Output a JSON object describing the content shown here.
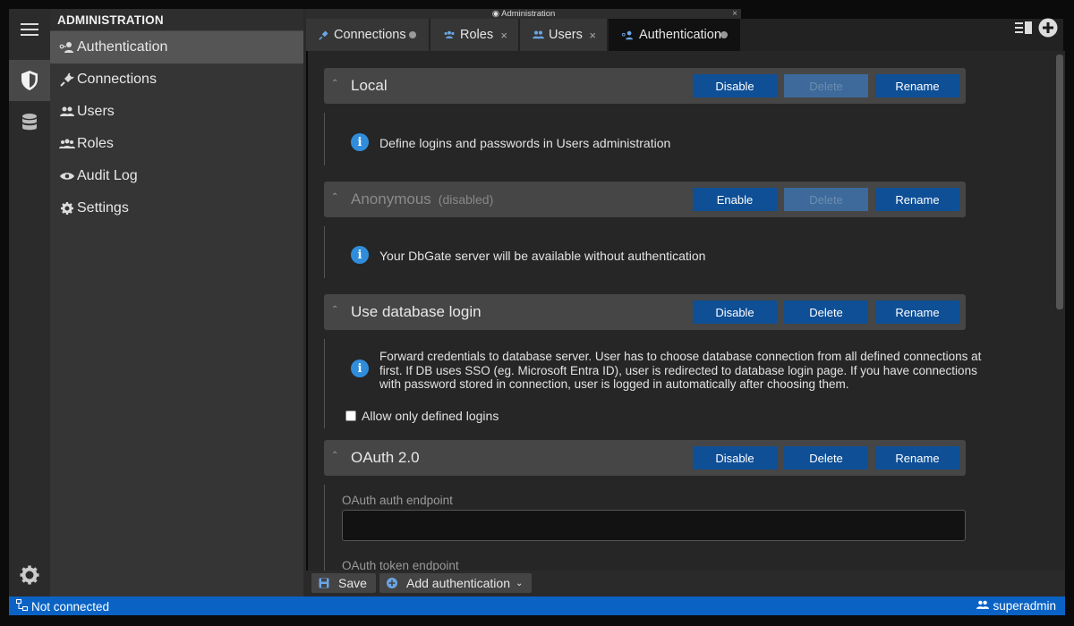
{
  "window_title": "Administration",
  "sidebar": {
    "header": "ADMINISTRATION",
    "items": [
      {
        "label": "Authentication",
        "icon": "user-key-icon"
      },
      {
        "label": "Connections",
        "icon": "plug-icon"
      },
      {
        "label": "Users",
        "icon": "users-icon"
      },
      {
        "label": "Roles",
        "icon": "roles-icon"
      },
      {
        "label": "Audit Log",
        "icon": "eye-icon"
      },
      {
        "label": "Settings",
        "icon": "gear-icon"
      }
    ]
  },
  "tabs": [
    {
      "label": "Connections",
      "mark": "dot"
    },
    {
      "label": "Roles",
      "mark": "×"
    },
    {
      "label": "Users",
      "mark": "×"
    },
    {
      "label": "Authentication",
      "mark": "dot",
      "active": true
    }
  ],
  "buttons": {
    "enable": "Enable",
    "disable": "Disable",
    "delete": "Delete",
    "rename": "Rename"
  },
  "sections": {
    "local": {
      "name": "Local",
      "info": "Define logins and passwords in Users administration"
    },
    "anonymous": {
      "name": "Anonymous",
      "state": "(disabled)",
      "info": "Your DbGate server will be available without authentication"
    },
    "dblogin": {
      "name": "Use database login",
      "info_lines": [
        "Forward credentials to database server. User has to choose database connection from all defined connections at",
        "first. If DB uses SSO (eg. Microsoft Entra ID), user is redirected to database login page. If you have connections",
        "with password stored in connection, user is logged in automatically after choosing them."
      ],
      "checkbox_label": "Allow only defined logins",
      "checkbox_checked": false
    },
    "oauth": {
      "name": "OAuth 2.0",
      "auth_endpoint_label": "OAuth auth endpoint",
      "auth_endpoint_value": "",
      "token_endpoint_label": "OAuth token endpoint"
    }
  },
  "toolbar": {
    "save_label": "Save",
    "add_auth_label": "Add authentication"
  },
  "status": {
    "connection": "Not connected",
    "user": "superadmin"
  },
  "colors": {
    "accent": "#0e4f96",
    "status_bar": "#0a63c4",
    "info_icon": "#2f8ddb"
  }
}
